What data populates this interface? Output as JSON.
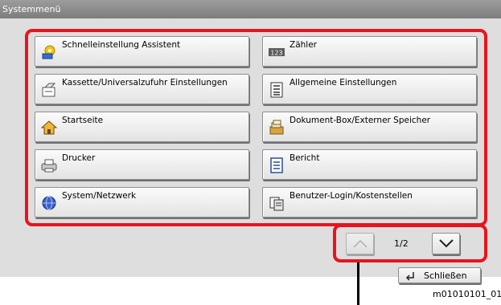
{
  "window": {
    "title": "Systemmenü"
  },
  "menu": {
    "items": [
      {
        "label": "Schnelleinstellung Assistent",
        "icon": "wizard-icon"
      },
      {
        "label": "Zähler",
        "icon": "counter-icon"
      },
      {
        "label": "Kassette/Universalzufuhr Einstellungen",
        "icon": "cassette-icon"
      },
      {
        "label": "Allgemeine Einstellungen",
        "icon": "settings-list-icon"
      },
      {
        "label": "Startseite",
        "icon": "home-icon"
      },
      {
        "label": "Dokument-Box/Externer Speicher",
        "icon": "document-box-icon"
      },
      {
        "label": "Drucker",
        "icon": "printer-icon"
      },
      {
        "label": "Bericht",
        "icon": "report-icon"
      },
      {
        "label": "System/Netzwerk",
        "icon": "network-icon"
      },
      {
        "label": "Benutzer-Login/Kostenstellen",
        "icon": "user-login-icon"
      }
    ],
    "counter_icon_text": "123"
  },
  "pager": {
    "page_indicator": "1/2",
    "page_current": 1,
    "page_total": 2,
    "up_icon": "chevron-up-icon",
    "down_icon": "chevron-down-icon"
  },
  "close_button": {
    "label": "Schließen",
    "icon": "return-arrow-icon"
  },
  "figure_code": "m01010101_01",
  "colors": {
    "highlight": "#e8141d",
    "titlebar": "#8a8a8a",
    "panel": "#dedede"
  }
}
